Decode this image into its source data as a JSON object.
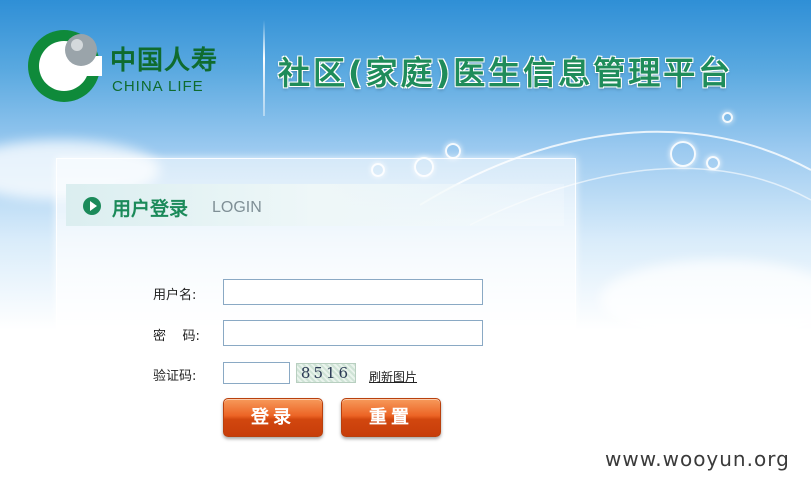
{
  "brand": {
    "name_cn": "中国人寿",
    "name_en": "CHINA LIFE",
    "logo_colors": [
      "#0f8a3a",
      "#9aa4aa"
    ]
  },
  "platform": {
    "title": "社区(家庭)医生信息管理平台",
    "title_color": "#1f8c5a"
  },
  "login": {
    "heading": "用户登录",
    "heading_en": "LOGIN",
    "username_label": "用户名:",
    "password_label": "密    码:",
    "captcha_label": "验证码:",
    "username_value": "",
    "password_value": "",
    "captcha_value": "",
    "captcha_text": "8516",
    "refresh_link": "刷新图片",
    "login_button": "登录",
    "reset_button": "重置",
    "button_color": "#e05a1c"
  },
  "watermark": "www.wooyun.org"
}
